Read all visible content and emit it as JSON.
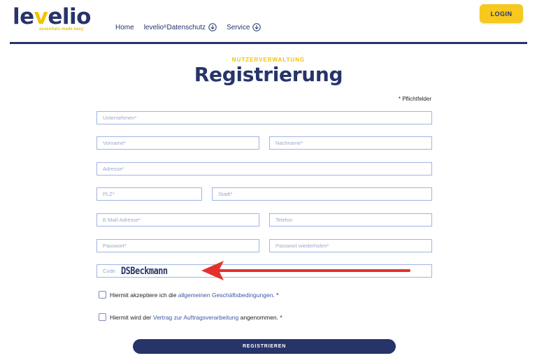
{
  "header": {
    "logo": {
      "prefix": "le",
      "accent": "v",
      "suffix": "elio",
      "tagline": "essentials made easy"
    },
    "nav": [
      {
        "label": "Home",
        "has_icon": false
      },
      {
        "label": "levelio",
        "sup": "®",
        "rest": " Datenschutz",
        "has_icon": true,
        "icon": "download-circle-icon"
      },
      {
        "label": "Service",
        "has_icon": true,
        "icon": "download-circle-icon"
      }
    ],
    "login_label": "LOGIN"
  },
  "page": {
    "eyebrow": "NUTZERVERWALTUNG",
    "title": "Registrierung",
    "required_note": "* Pflichtfelder"
  },
  "form": {
    "fields": {
      "company": {
        "placeholder": "Unternehmen*"
      },
      "first_name": {
        "placeholder": "Vorname*"
      },
      "last_name": {
        "placeholder": "Nachname*"
      },
      "address": {
        "placeholder": "Adresse*"
      },
      "zip": {
        "placeholder": "PLZ*"
      },
      "city": {
        "placeholder": "Stadt*"
      },
      "email": {
        "placeholder": "E-Mail-Adresse*"
      },
      "phone": {
        "placeholder": "Telefon"
      },
      "password": {
        "placeholder": "Passwort*"
      },
      "password_repeat": {
        "placeholder": "Passwort wiederholen*"
      },
      "code": {
        "label": "Code",
        "value": "DSBeckmann"
      }
    },
    "terms": {
      "before": "Hiermit akzeptiere ich die ",
      "link": "allgemeinen Geschäftsbedingungen",
      "after": ". *"
    },
    "dpa": {
      "before": "Hiermit wird der ",
      "link": "Vertrag zur Auftragsverarbeitung",
      "after": " angenommen. *"
    },
    "submit_label": "REGISTRIEREN"
  },
  "colors": {
    "brand_navy": "#27346a",
    "brand_yellow": "#f7c81e",
    "field_border": "#9fb4e3",
    "annotation_arrow": "#e5312b"
  }
}
